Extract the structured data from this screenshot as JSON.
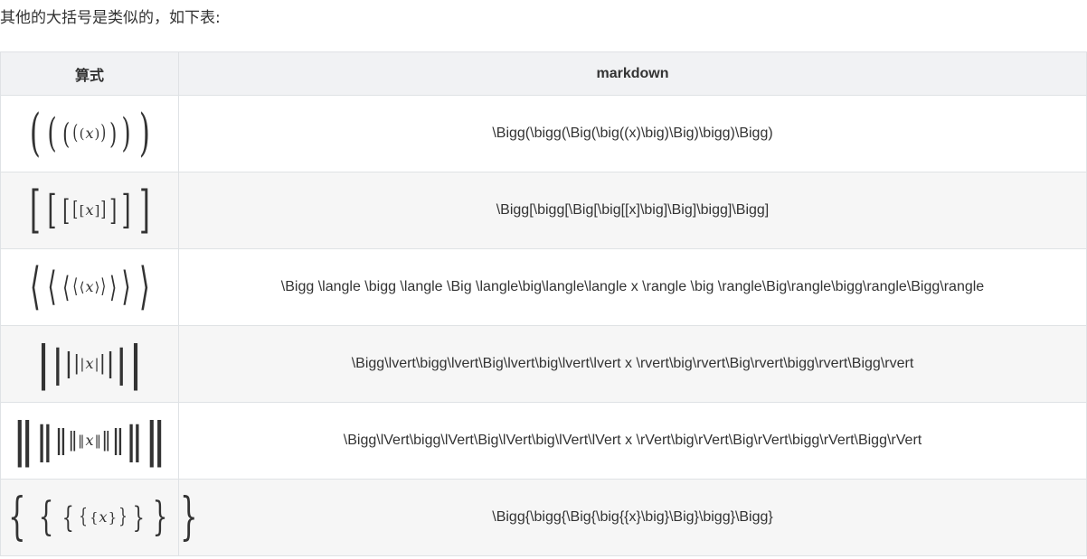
{
  "intro": "其他的大括号是类似的，如下表:",
  "table": {
    "headers": {
      "formula": "算式",
      "markdown": "markdown"
    },
    "rows": [
      {
        "delims": {
          "open": [
            "(",
            "(",
            "(",
            "(",
            "("
          ],
          "close": [
            ")",
            ")",
            ")",
            ")",
            ")"
          ]
        },
        "variable": "x",
        "markdown": "\\Bigg(\\bigg(\\Big(\\big((x)\\big)\\Big)\\bigg)\\Bigg)"
      },
      {
        "delims": {
          "open": [
            "[",
            "[",
            "[",
            "[",
            "["
          ],
          "close": [
            "]",
            "]",
            "]",
            "]",
            "]"
          ]
        },
        "variable": "x",
        "markdown": "\\Bigg[\\bigg[\\Big[\\big[[x]\\big]\\Big]\\bigg]\\Bigg]"
      },
      {
        "delims": {
          "open": [
            "⟨",
            "⟨",
            "⟨",
            "⟨",
            "⟨"
          ],
          "close": [
            "⟩",
            "⟩",
            "⟩",
            "⟩",
            "⟩"
          ]
        },
        "variable": "x",
        "markdown": "\\Bigg \\langle \\bigg \\langle \\Big \\langle\\big\\langle\\langle x \\rangle \\big \\rangle\\Big\\rangle\\bigg\\rangle\\Bigg\\rangle"
      },
      {
        "delims": {
          "open": [
            "|",
            "|",
            "|",
            "|",
            "|"
          ],
          "close": [
            "|",
            "|",
            "|",
            "|",
            "|"
          ]
        },
        "variable": "x",
        "markdown": "\\Bigg\\lvert\\bigg\\lvert\\Big\\lvert\\big\\lvert\\lvert x \\rvert\\big\\rvert\\Big\\rvert\\bigg\\rvert\\Bigg\\rvert"
      },
      {
        "delims": {
          "open": [
            "‖",
            "‖",
            "‖",
            "‖",
            "‖"
          ],
          "close": [
            "‖",
            "‖",
            "‖",
            "‖",
            "‖"
          ]
        },
        "variable": "x",
        "markdown": "\\Bigg\\lVert\\bigg\\lVert\\Big\\lVert\\big\\lVert\\lVert x \\rVert\\big\\rVert\\Big\\rVert\\bigg\\rVert\\Bigg\\rVert"
      },
      {
        "delims": {
          "open": [
            "{",
            "{",
            "{",
            "{",
            "{"
          ],
          "close": [
            "}",
            "}",
            "}",
            "}",
            "}"
          ]
        },
        "variable": "x",
        "markdown": "\\Bigg{\\bigg{\\Big{\\big{{x}\\big}\\Big}\\bigg}\\Bigg}"
      }
    ]
  }
}
